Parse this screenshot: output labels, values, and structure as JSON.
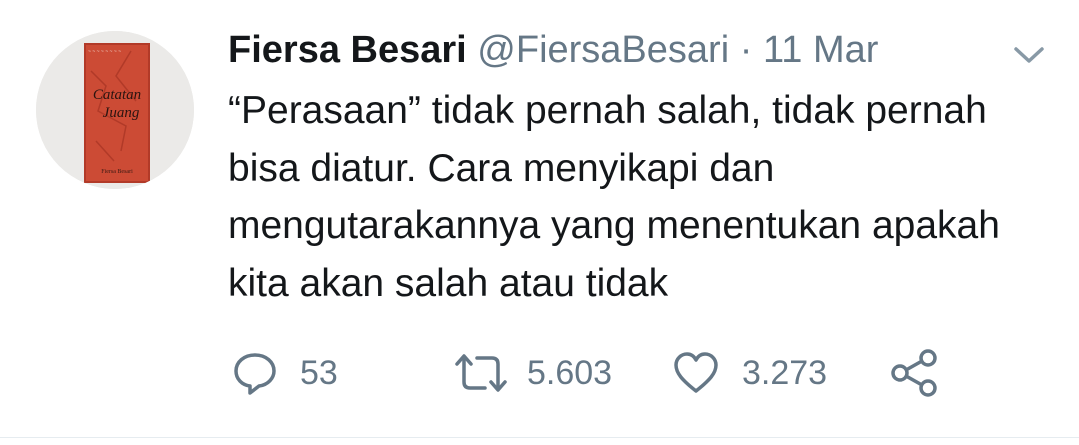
{
  "tweet": {
    "author_name": "Fiersa Besari",
    "author_handle": "@FiersaBesari",
    "separator": "·",
    "date": "11 Mar",
    "text": "“Perasaan” tidak pernah salah, tidak pernah bisa diatur. Cara menyikapi dan mengutarakannya yang menentukan apakah kita akan salah atau tidak",
    "avatar": {
      "icon": "book-cover-icon",
      "cover_title_line1": "Catatan",
      "cover_title_line2": "Juang",
      "cover_author": "Fiersa Besari"
    }
  },
  "actions": {
    "reply_count": "53",
    "retweet_count": "5.603",
    "like_count": "3.273"
  },
  "colors": {
    "text_primary": "#14171a",
    "text_secondary": "#657786",
    "icon": "#657786",
    "book_red": "#c8432f"
  }
}
